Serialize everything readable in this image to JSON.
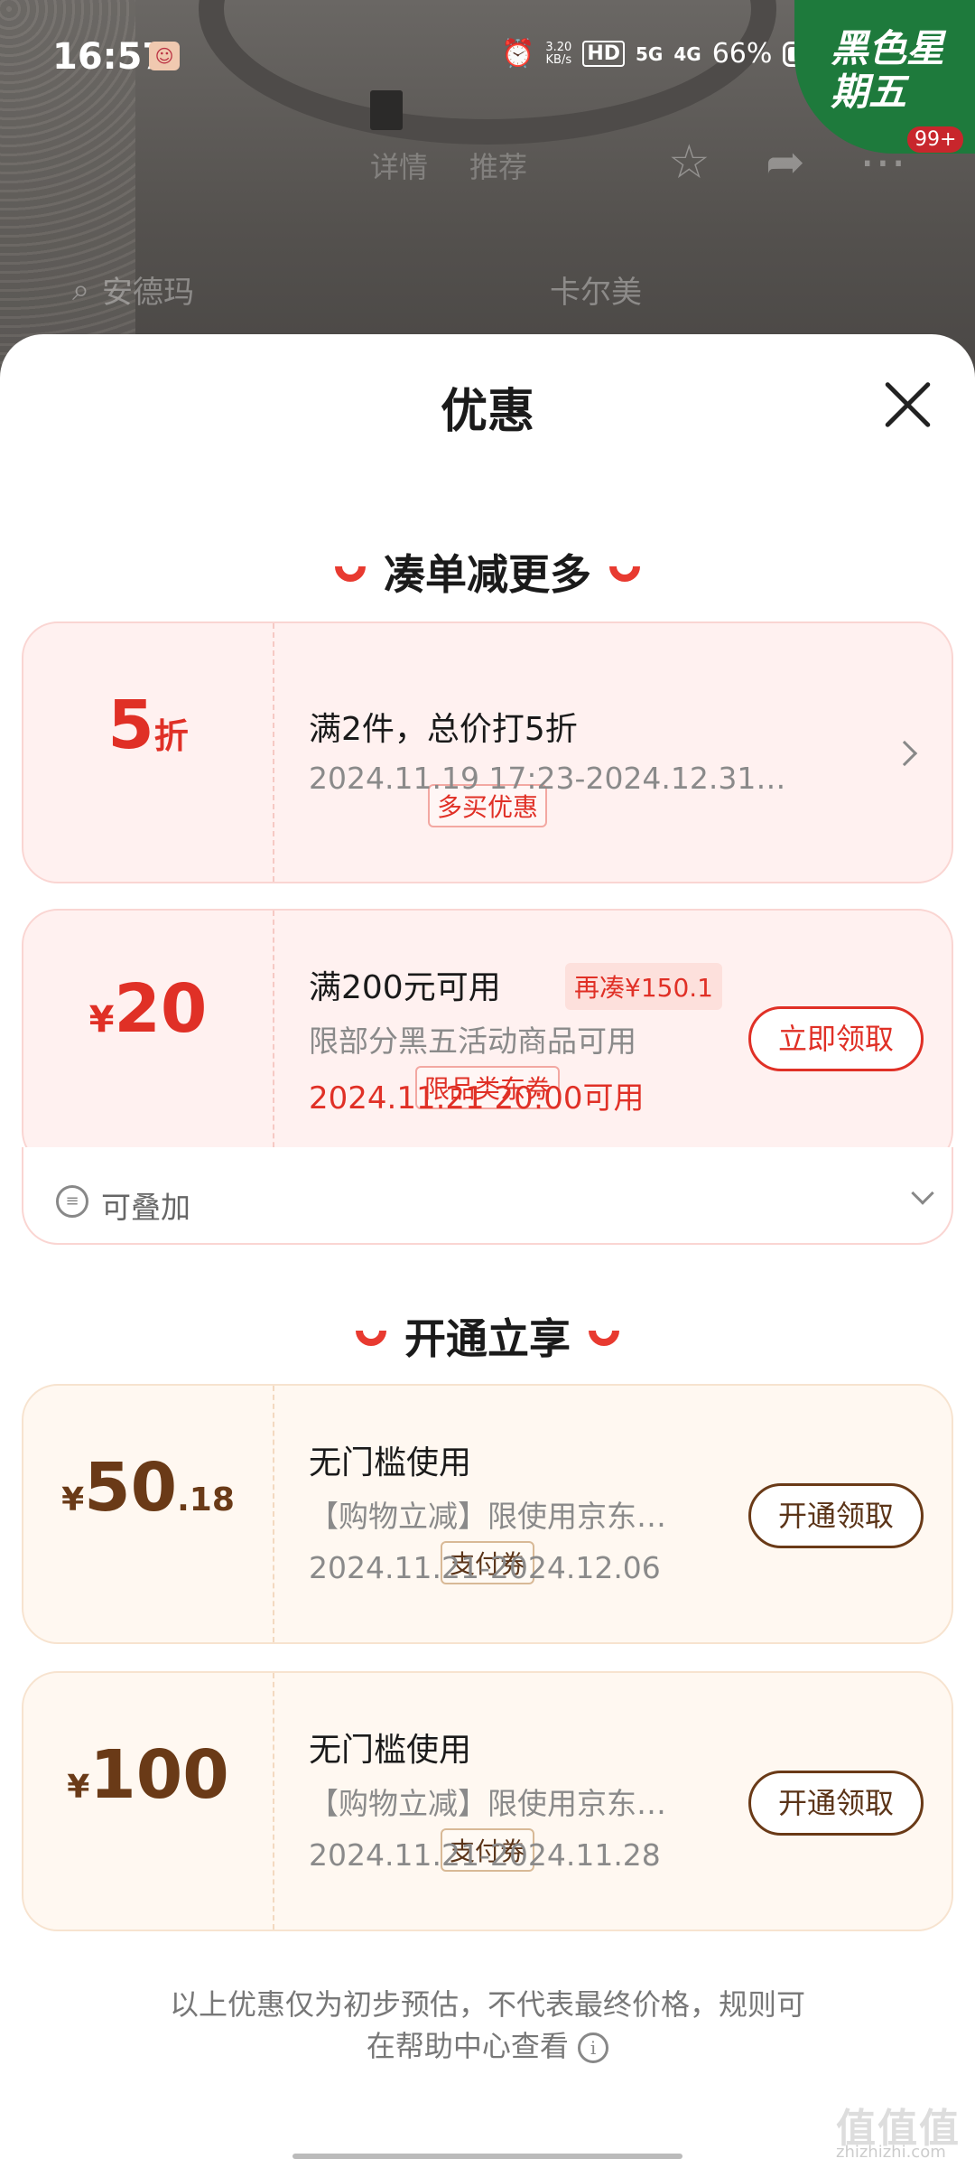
{
  "status_bar": {
    "time": "16:57",
    "net_speed": "3.20",
    "net_unit": "KB/s",
    "hd": "HD",
    "sig5g": "5G",
    "sig4g": "4G",
    "battery": "66%"
  },
  "promo_badge": {
    "text": "黑色星期五",
    "count": "99+"
  },
  "background": {
    "nav_items": [
      "详情",
      "推荐"
    ],
    "search_items": [
      "安德玛",
      "卡尔美"
    ]
  },
  "sheet": {
    "title": "优惠",
    "cut_text": "..."
  },
  "section1": {
    "title": "凑单减更多"
  },
  "coupon1": {
    "value": "5",
    "unit": "折",
    "tag": "多买优惠",
    "title": "满2件，总价打5折",
    "period": "2024.11.19 17:23-2024.12.31…"
  },
  "coupon2": {
    "currency": "¥",
    "value": "20",
    "tag": "限品类东券",
    "title": "满200元可用",
    "addon": "再凑¥150.1",
    "desc": "限部分黑五活动商品可用",
    "start": "2024.11.21 20:00可用",
    "button": "立即领取",
    "stack_label": "可叠加"
  },
  "section2": {
    "title": "开通立享"
  },
  "coupon3": {
    "currency": "¥",
    "value": "50",
    "decimal": ".18",
    "tag": "支付券",
    "title": "无门槛使用",
    "desc": "【购物立减】限使用京东…",
    "period": "2024.11.21-2024.12.06",
    "button": "开通领取"
  },
  "coupon4": {
    "currency": "¥",
    "value": "100",
    "tag": "支付券",
    "title": "无门槛使用",
    "desc": "【购物立减】限使用京东…",
    "period": "2024.11.21-2024.11.28",
    "button": "开通领取"
  },
  "footnote": {
    "line1": "以上优惠仅为初步预估，不代表最终价格，规则可",
    "line2": "在帮助中心查看"
  },
  "watermark": {
    "text": "值值值",
    "sub": "zhizhizhi.com"
  },
  "colors": {
    "accent_red": "#e03026",
    "gold_brown": "#6a3a17",
    "promo_green": "#1e7a3c"
  }
}
